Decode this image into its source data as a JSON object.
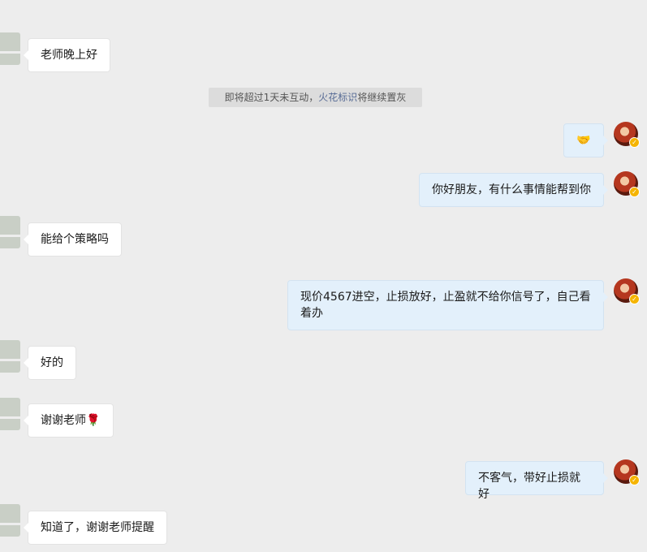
{
  "system_notice": {
    "prefix": "即将超过1天未互动，",
    "link": "火花标识",
    "suffix": "将继续置灰"
  },
  "messages": [
    {
      "side": "left",
      "text": "老师晚上好"
    },
    {
      "side": "right",
      "text": "🤝",
      "icon": "handshake-emoji"
    },
    {
      "side": "right",
      "text": "你好朋友，有什么事情能帮到你"
    },
    {
      "side": "left",
      "text": "能给个策略吗"
    },
    {
      "side": "right",
      "text": "现价4567进空，止损放好，止盈就不给你信号了，自己看着办"
    },
    {
      "side": "left",
      "text": "好的"
    },
    {
      "side": "left",
      "text": "谢谢老师🌹"
    },
    {
      "side": "right",
      "text": "不客气，带好止损就好"
    },
    {
      "side": "left",
      "text": "知道了，谢谢老师提醒"
    }
  ],
  "colors": {
    "background": "#ededed",
    "left_bubble": "#ffffff",
    "right_bubble": "#e3f0fb",
    "link": "#576b95",
    "verified_badge": "#f5b400"
  }
}
